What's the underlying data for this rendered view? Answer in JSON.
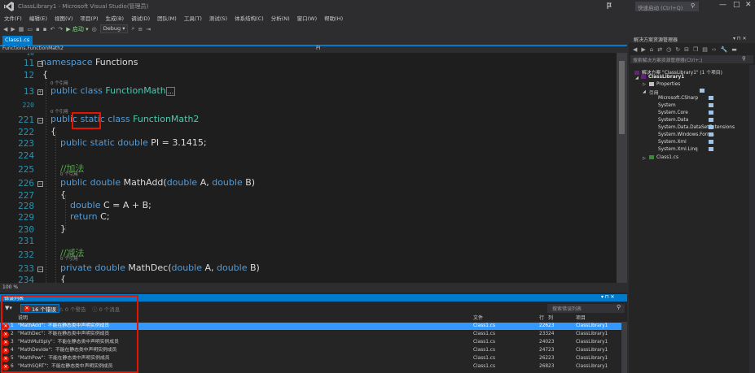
{
  "window": {
    "title": "ClassLibrary1 - Microsoft Visual Studio(管理员)",
    "quick_launch_placeholder": "快速启动 (Ctrl+Q)",
    "minimize": "—",
    "maximize": "□",
    "close": "✕"
  },
  "menu": [
    "文件(F)",
    "编辑(E)",
    "视图(V)",
    "项目(P)",
    "生成(B)",
    "调试(D)",
    "团队(M)",
    "工具(T)",
    "测试(S)",
    "体系结构(C)",
    "分析(N)",
    "窗口(W)",
    "帮助(H)"
  ],
  "toolbar": {
    "start_label": "▶ 启动 ▾",
    "config": "Debug ▾"
  },
  "doc_tab": {
    "label": "Class1.cs"
  },
  "navbar": {
    "left": "Functions.FunctionMath2",
    "right": "PI"
  },
  "editor": {
    "line_numbers": [
      "10",
      "11",
      "12",
      "13",
      "220",
      "221",
      "222",
      "223",
      "224",
      "225",
      "226",
      "227",
      "228",
      "229",
      "230",
      "231",
      "232",
      "233",
      "234"
    ],
    "ref_hint": "0 个引用",
    "lines": {
      "l11_kw": "namespace",
      "l11_name": " Functions",
      "l12": "{",
      "l13_kw": "public class",
      "l13_cls": " FunctionMath",
      "l13_collapsed": "...",
      "l221_kw1": "public",
      "l221_kw2": " static",
      "l221_kw3": " class",
      "l221_cls": " FunctionMath2",
      "l222": "{",
      "l223_kw": "public static double",
      "l223_rest": " PI = 3.1415;",
      "l225_cmt": "//加法",
      "l226_kw1": "public double",
      "l226_name": " MathAdd(",
      "l226_kw2": "double",
      "l226_mid": " A, ",
      "l226_kw3": "double",
      "l226_end": " B)",
      "l227": "{",
      "l228_kw": "double",
      "l228_rest": " C = A + B;",
      "l229_kw": "return",
      "l229_rest": " C;",
      "l230": "}",
      "l232_cmt": "//减法",
      "l233_kw1": "private double",
      "l233_name": " MathDec(",
      "l233_kw2": "double",
      "l233_mid": " A, ",
      "l233_kw3": "double",
      "l233_end": " B)",
      "l234": "{"
    }
  },
  "zoom": "100 %",
  "error_list": {
    "title": "错误列表",
    "title_icons": "▾ ⊓ ✕",
    "errors_btn": "16 个错误",
    "warnings_btn": "⚠ 0 个警告",
    "messages_btn": "ⓘ 0 个消息",
    "search_placeholder": "搜索错误列表",
    "headers": {
      "desc": "说明",
      "file": "文件",
      "line": "行",
      "col": "列",
      "project": "项目"
    },
    "rows": [
      {
        "num": "1",
        "desc": "\"MathAdd\"：不能在静态类中声明实例成员",
        "file": "Class1.cs",
        "line": "226",
        "col": "23",
        "project": "ClassLibrary1"
      },
      {
        "num": "2",
        "desc": "\"MathDec\"：不能在静态类中声明实例成员",
        "file": "Class1.cs",
        "line": "233",
        "col": "24",
        "project": "ClassLibrary1"
      },
      {
        "num": "3",
        "desc": "\"MathMultiply\"：不能在静态类中声明实例成员",
        "file": "Class1.cs",
        "line": "240",
        "col": "23",
        "project": "ClassLibrary1"
      },
      {
        "num": "4",
        "desc": "\"MathDevide\"：不能在静态类中声明实例成员",
        "file": "Class1.cs",
        "line": "247",
        "col": "23",
        "project": "ClassLibrary1"
      },
      {
        "num": "5",
        "desc": "\"MathPow\"：不能在静态类中声明实例成员",
        "file": "Class1.cs",
        "line": "262",
        "col": "23",
        "project": "ClassLibrary1"
      },
      {
        "num": "6",
        "desc": "\"MathSQRT\"：不能在静态类中声明实例成员",
        "file": "Class1.cs",
        "line": "268",
        "col": "23",
        "project": "ClassLibrary1"
      }
    ]
  },
  "solution_explorer": {
    "title": "解决方案资源管理器",
    "title_icons": "▾ ⊓ ✕",
    "search_placeholder": "搜索解决方案资源管理器(Ctrl+;)",
    "items": {
      "solution": "解决方案 \"ClassLibrary1\" (1 个项目)",
      "project": "ClassLibrary1",
      "properties": "Properties",
      "references": "引用",
      "refs": [
        "Microsoft.CSharp",
        "System",
        "System.Core",
        "System.Data",
        "System.Data.DataSetExtensions",
        "System.Windows.Forms",
        "System.Xml",
        "System.Xml.Linq"
      ],
      "class1": "Class1.cs"
    }
  },
  "colors": {
    "accent": "#007acc",
    "error": "#e51400",
    "keyword": "#569cd6",
    "type": "#4ec9b0",
    "comment": "#57a64a",
    "line_number": "#2b91af"
  }
}
